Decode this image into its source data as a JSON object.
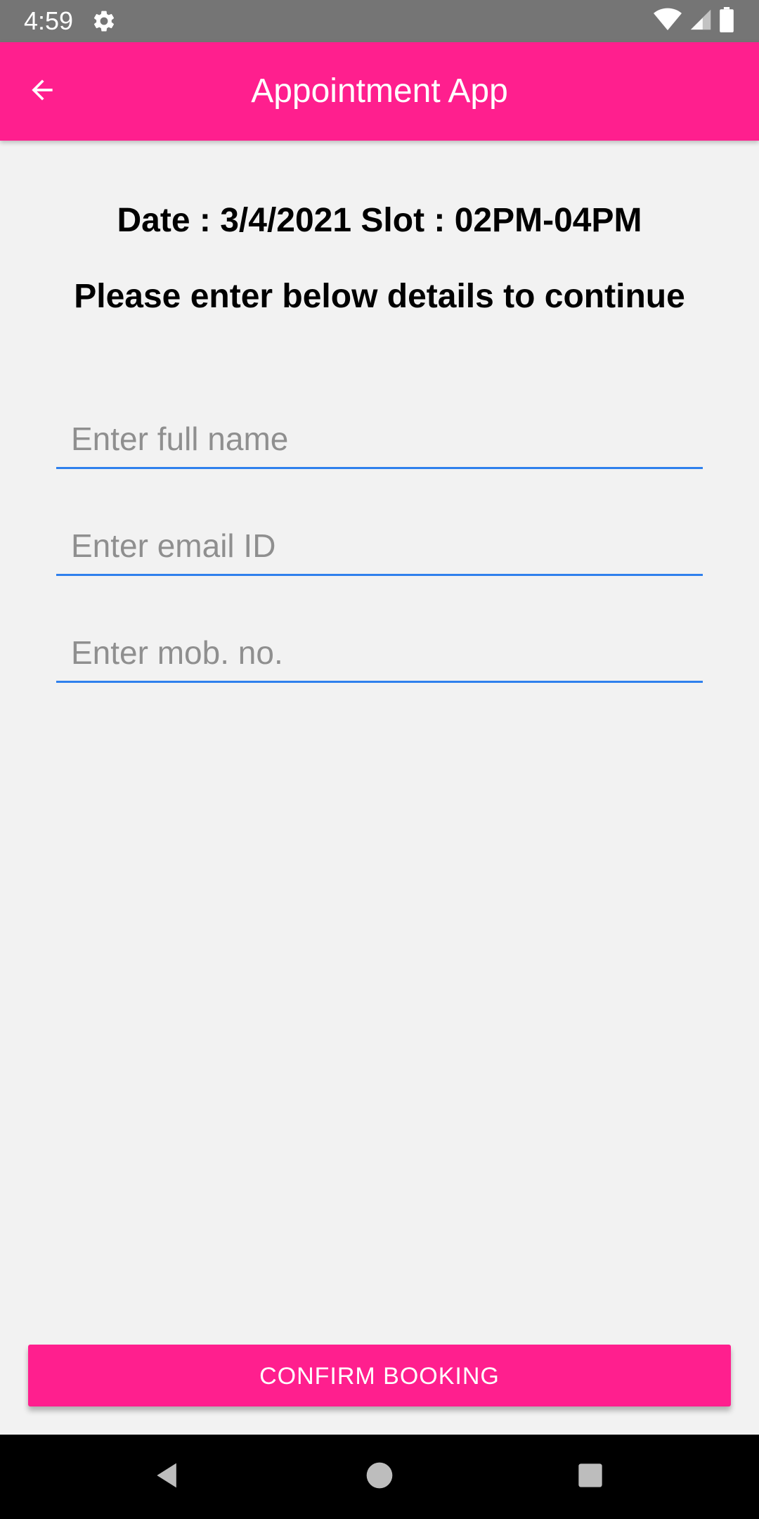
{
  "status_bar": {
    "time": "4:59",
    "icons": [
      "settings-gear-icon",
      "wifi-icon",
      "cellular-signal-icon",
      "battery-icon"
    ]
  },
  "app_bar": {
    "title": "Appointment App",
    "back_icon": "arrow-left-icon",
    "color": "#ff1f8e"
  },
  "booking": {
    "date_slot": "Date : 3/4/2021 Slot : 02PM-04PM",
    "instruction": "Please enter below details to continue"
  },
  "form": {
    "name": {
      "placeholder": "Enter full name",
      "value": ""
    },
    "email": {
      "placeholder": "Enter email ID",
      "value": ""
    },
    "mobile": {
      "placeholder": "Enter mob. no.",
      "value": ""
    },
    "underline_color": "#2f80ed"
  },
  "confirm_button": {
    "label": "CONFIRM BOOKING",
    "color": "#ff1f8e"
  },
  "nav_bar": {
    "icons": [
      "nav-back-icon",
      "nav-home-icon",
      "nav-recents-icon"
    ]
  }
}
